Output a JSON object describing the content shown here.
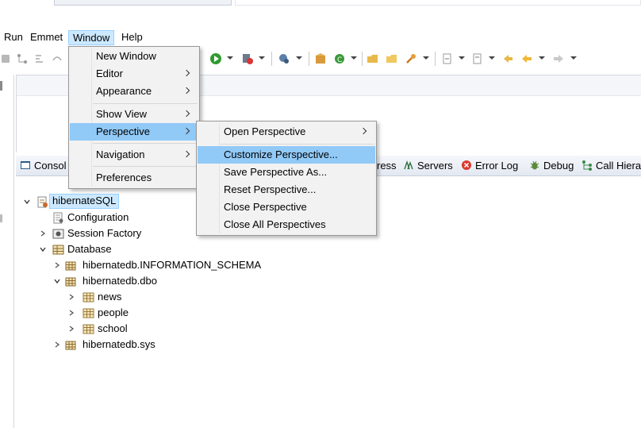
{
  "menubar": {
    "items": [
      "Run",
      "Emmet",
      "Window",
      "Help"
    ],
    "active": "Window"
  },
  "window_menu": {
    "items": [
      {
        "label": "New Window",
        "submenu": false
      },
      {
        "label": "Editor",
        "submenu": true
      },
      {
        "label": "Appearance",
        "submenu": true
      },
      {
        "label": "Show View",
        "submenu": true
      },
      {
        "label": "Perspective",
        "submenu": true,
        "highlighted": true
      },
      {
        "label": "Navigation",
        "submenu": true
      },
      {
        "label": "Preferences",
        "submenu": false
      }
    ]
  },
  "perspective_menu": {
    "items": [
      {
        "label": "Open Perspective",
        "submenu": true
      },
      {
        "label": "Customize Perspective...",
        "submenu": false,
        "highlighted": true
      },
      {
        "label": "Save Perspective As...",
        "submenu": false
      },
      {
        "label": "Reset Perspective...",
        "submenu": false
      },
      {
        "label": "Close Perspective",
        "submenu": false
      },
      {
        "label": "Close All Perspectives",
        "submenu": false
      }
    ]
  },
  "view_tabs": [
    "Consol",
    "ress",
    "Servers",
    "Error Log",
    "Debug",
    "Call Hiera"
  ],
  "tree": {
    "root": "hibernateSQL",
    "configuration": "Configuration",
    "session_factory": "Session Factory",
    "database": "Database",
    "schemas": [
      {
        "name": "hibernatedb.INFORMATION_SCHEMA",
        "expanded": false
      },
      {
        "name": "hibernatedb.dbo",
        "expanded": true,
        "tables": [
          "news",
          "people",
          "school"
        ]
      },
      {
        "name": "hibernatedb.sys",
        "expanded": false
      }
    ]
  },
  "colors": {
    "menu_highlight": "#91c9f7",
    "selection": "#cce8ff",
    "menu_bg": "#f2f2f2"
  }
}
